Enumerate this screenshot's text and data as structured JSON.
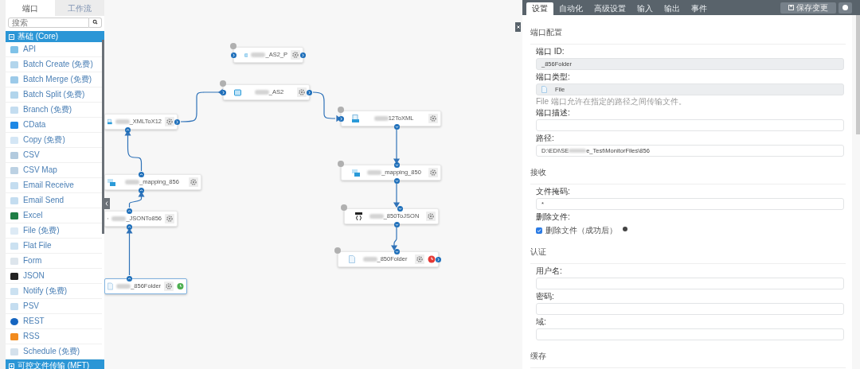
{
  "sidebar": {
    "tabs": [
      {
        "label": "端口",
        "selected": true
      },
      {
        "label": "工作流",
        "selected": false
      }
    ],
    "search": {
      "placeholder": "搜索"
    },
    "groups": [
      {
        "label": "基础 (Core)",
        "expanded": true,
        "items": [
          {
            "label": "API"
          },
          {
            "label": "Batch Create (免费)"
          },
          {
            "label": "Batch Merge (免费)"
          },
          {
            "label": "Batch Split (免费)"
          },
          {
            "label": "Branch (免费)"
          },
          {
            "label": "CData"
          },
          {
            "label": "Copy (免费)"
          },
          {
            "label": "CSV"
          },
          {
            "label": "CSV Map"
          },
          {
            "label": "Email Receive"
          },
          {
            "label": "Email Send"
          },
          {
            "label": "Excel"
          },
          {
            "label": "File (免费)"
          },
          {
            "label": "Flat File"
          },
          {
            "label": "Form"
          },
          {
            "label": "JSON"
          },
          {
            "label": "Notify (免费)"
          },
          {
            "label": "PSV"
          },
          {
            "label": "REST"
          },
          {
            "label": "RSS"
          },
          {
            "label": "Schedule (免费)"
          }
        ]
      },
      {
        "label": "可控文件传输 (MFT)",
        "expanded": false
      }
    ]
  },
  "canvas": {
    "nodes": [
      {
        "label": "_AS2_P",
        "kind": "as2",
        "selected": false
      },
      {
        "label": "_AS2",
        "kind": "as2",
        "selected": false
      },
      {
        "label": "_XMLToX12",
        "kind": "xml",
        "selected": false
      },
      {
        "label": "12ToXML",
        "kind": "xml",
        "selected": false
      },
      {
        "label": "_mapping_856",
        "kind": "map",
        "selected": false
      },
      {
        "label": "_mapping_850",
        "kind": "map",
        "selected": false
      },
      {
        "label": "_JSONTo856",
        "kind": "json",
        "selected": false
      },
      {
        "label": "_850ToJSON",
        "kind": "json",
        "selected": false
      },
      {
        "label": "_856Folder",
        "kind": "file",
        "selected": true,
        "color": "#4caf50"
      },
      {
        "label": "_850Folder",
        "kind": "file",
        "selected": false,
        "color": "#e53935"
      }
    ]
  },
  "panel": {
    "tabs": [
      {
        "label": "设置",
        "selected": true
      },
      {
        "label": "自动化",
        "selected": false
      },
      {
        "label": "高级设置",
        "selected": false
      },
      {
        "label": "输入",
        "selected": false
      },
      {
        "label": "输出",
        "selected": false
      },
      {
        "label": "事件",
        "selected": false
      }
    ],
    "save_button": "保存变更",
    "sections": [
      {
        "title": "端口配置",
        "fields": [
          {
            "kind": "text",
            "label": "端口 ID:",
            "value": "_856Folder",
            "disabled": true
          },
          {
            "kind": "type",
            "label": "端口类型:",
            "value": "File",
            "disabled": true,
            "hint": "File 端口允许在指定的路径之间传输文件。"
          },
          {
            "kind": "text",
            "label": "端口描述:",
            "disabled": false
          },
          {
            "kind": "path",
            "label": "路径:",
            "value": "D:\\EDI\\SE",
            "value_end": "e_Test\\MonitorFiles\\856",
            "disabled": false
          }
        ]
      },
      {
        "title": "接收",
        "fields": [
          {
            "kind": "text",
            "label": "文件掩码:",
            "value": "*",
            "disabled": false
          },
          {
            "kind": "checkbox",
            "label": "删除文件:",
            "option": "删除文件（成功后）",
            "checked": true
          }
        ]
      },
      {
        "title": "认证",
        "fields": [
          {
            "kind": "text",
            "label": "用户名:",
            "disabled": false
          },
          {
            "kind": "text",
            "label": "密码:",
            "disabled": false
          },
          {
            "kind": "text",
            "label": "域:",
            "disabled": false
          }
        ]
      },
      {
        "title": "缓存"
      }
    ]
  }
}
